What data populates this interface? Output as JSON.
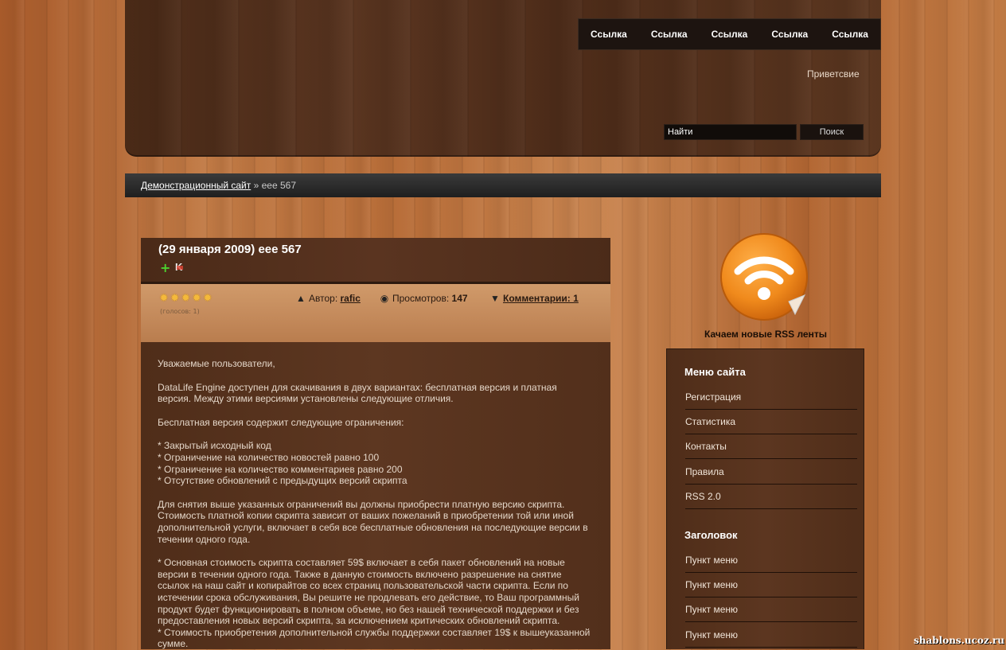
{
  "nav": {
    "links": [
      "Ссылка",
      "Ссылка",
      "Ссылка",
      "Ссылка",
      "Ссылка"
    ]
  },
  "header": {
    "greeting": "Приветсвие"
  },
  "search": {
    "placeholder": "Найти",
    "button": "Поиск"
  },
  "breadcrumb": {
    "home": "Демонстрационный сайт",
    "separator": "»",
    "current": "eee 567"
  },
  "article": {
    "title": "(29 января 2009) eee 567",
    "rating": {
      "stars": 5,
      "votes_text": "(голосов: 1)"
    },
    "author_label": "Автор:",
    "author": "rafic",
    "views_label": "Просмотров:",
    "views": "147",
    "comments_label": "Комментарии: 1",
    "paragraphs": [
      "Уважаемые пользователи,",
      "DataLife Engine доступен для скачивания в двух вариантах: бесплатная версия и платная версия. Между этими версиями установлены следующие отличия.",
      "Бесплатная версия содержит следующие ограничения:",
      "* Закрытый исходный код\n* Ограничение на количество новостей равно 100\n* Ограничение на количество комментариев равно 200\n* Отсутствие обновлений с предыдущих версий скрипта",
      "Для снятия выше указанных ограничений вы должны приобрести платную версию скрипта. Стоимость платной копии скрипта зависит от ваших пожеланий в приобретении той или иной дополнительной услуги, включает в себя все бесплатные обновления на последующие версии в течении одного года.",
      "* Основная стоимость скрипта составляет 59$ включает в себя пакет обновлений на новые версии в течении одного года. Также в данную стоимость включено разрешение на снятие ссылок на наш сайт и копирайтов со всех страниц пользовательской части скрипта. Если по истечении срока обслуживания, Вы решите не продлевать его действие, то Ваш программный продукт будет функционировать в полном объеме, но без нашей технической поддержки и без предоставления новых версий скрипта, за исключением критических обновлений скрипта.\n* Стоимость приобретения дополнительной службы поддержки составляет 19$ к вышеуказанной сумме."
    ]
  },
  "rss": {
    "caption": "Качаем новые RSS ленты"
  },
  "sidebar": {
    "menu_title": "Меню сайта",
    "menu_items": [
      "Регистрация",
      "Статистика",
      "Контакты",
      "Правила",
      "RSS 2.0"
    ],
    "second_title": "Заголовок",
    "second_items": [
      "Пункт меню",
      "Пункт меню",
      "Пункт меню",
      "Пункт меню"
    ]
  },
  "watermark": "shablons.ucoz.ru",
  "colors": {
    "accent_orange": "#f08a1c",
    "header_brown": "#5a3520",
    "breadcrumb_dark": "#2b2b2b"
  }
}
